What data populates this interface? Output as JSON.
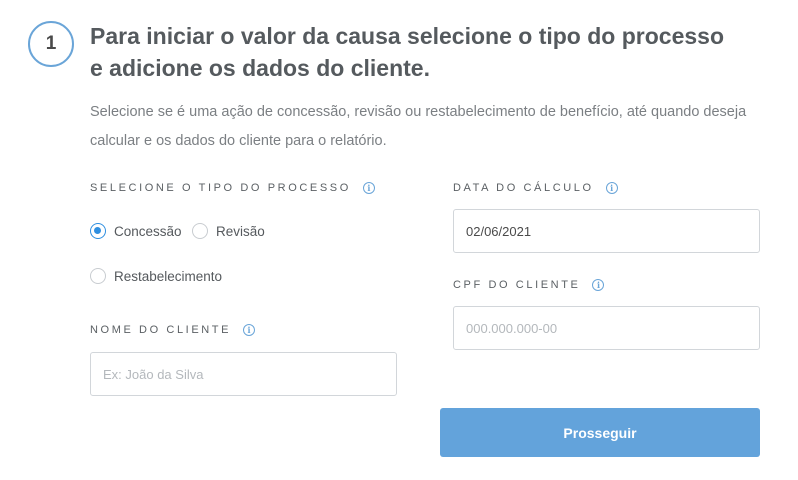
{
  "step": {
    "number": "1",
    "title": "Para iniciar o valor da causa selecione o tipo do processo e adicione os dados do cliente.",
    "description": "Selecione se é uma ação de concessão, revisão ou restabelecimento de benefício, até quando deseja calcular e os dados do cliente para o relatório."
  },
  "process_type": {
    "label": "SELECIONE O TIPO DO PROCESSO",
    "info_icon": "info-icon",
    "options": [
      {
        "label": "Concessão",
        "selected": true
      },
      {
        "label": "Revisão",
        "selected": false
      },
      {
        "label": "Restabelecimento",
        "selected": false
      }
    ]
  },
  "client_name": {
    "label": "NOME DO CLIENTE",
    "value": "",
    "placeholder": "Ex: João da Silva"
  },
  "calc_date": {
    "label": "DATA DO CÁLCULO",
    "value": "02/06/2021"
  },
  "client_cpf": {
    "label": "CPF DO CLIENTE",
    "value": "",
    "placeholder": "000.000.000-00"
  },
  "submit": {
    "label": "Prosseguir"
  },
  "colors": {
    "accent": "#2f8fe0",
    "button": "#63a3db",
    "circle_border": "#6aa5d8"
  }
}
